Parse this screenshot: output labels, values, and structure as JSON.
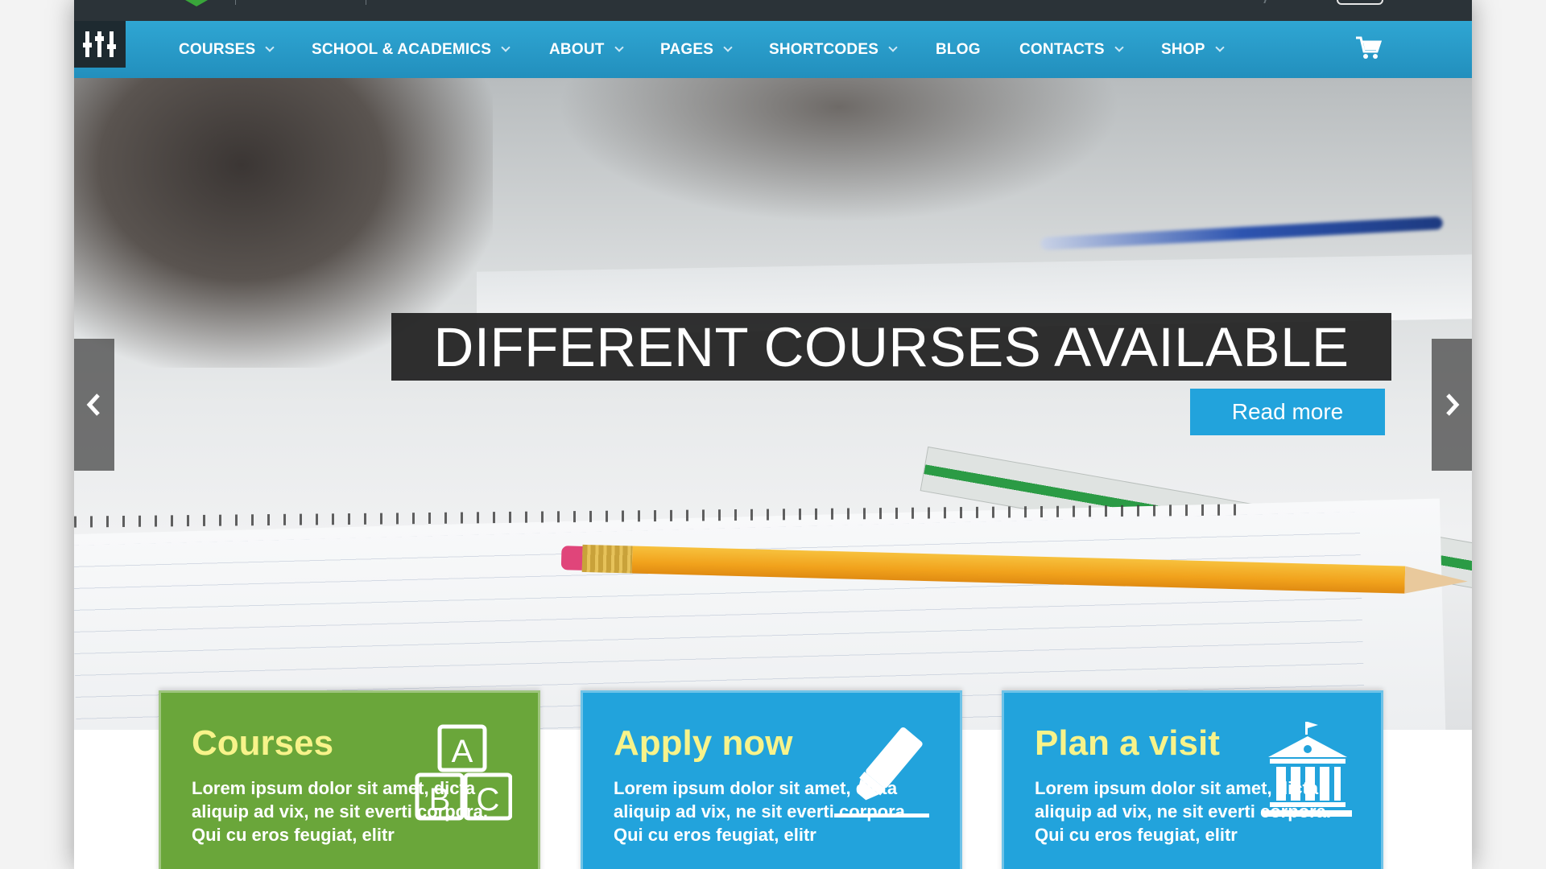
{
  "nav": {
    "items": [
      {
        "label": "COURSES",
        "has_dropdown": true
      },
      {
        "label": "SCHOOL & ACADEMICS",
        "has_dropdown": true
      },
      {
        "label": "ABOUT",
        "has_dropdown": true
      },
      {
        "label": "PAGES",
        "has_dropdown": true
      },
      {
        "label": "SHORTCODES",
        "has_dropdown": true
      },
      {
        "label": "BLOG",
        "has_dropdown": false
      },
      {
        "label": "CONTACTS",
        "has_dropdown": true
      },
      {
        "label": "SHOP",
        "has_dropdown": true
      }
    ],
    "cart_icon": "shopping-cart-icon",
    "logo_icon": "equalizer-logo-icon",
    "color": "#2fa6d3"
  },
  "hero": {
    "title": "DIFFERENT COURSES AVAILABLE",
    "button": "Read more",
    "prev_icon": "chevron-left-icon",
    "next_icon": "chevron-right-icon",
    "accent": "#22a3dc"
  },
  "cards": [
    {
      "title": "Courses",
      "text": "Lorem ipsum dolor sit amet, dicta aliquip ad vix, ne sit everti corpora. Qui cu eros feugiat, elitr",
      "icon": "abc-blocks-icon",
      "color": "#6aa63a"
    },
    {
      "title": "Apply now",
      "text": "Lorem ipsum dolor sit amet, dicta aliquip ad vix, ne sit everti corpora. Qui cu eros feugiat, elitr",
      "icon": "highlighter-icon",
      "color": "#22a3dc"
    },
    {
      "title": "Plan a visit",
      "text": "Lorem ipsum dolor sit amet, dicta aliquip ad vix, ne sit everti corpora. Qui cu eros feugiat, elitr",
      "icon": "school-building-icon",
      "color": "#22a3dc"
    }
  ]
}
